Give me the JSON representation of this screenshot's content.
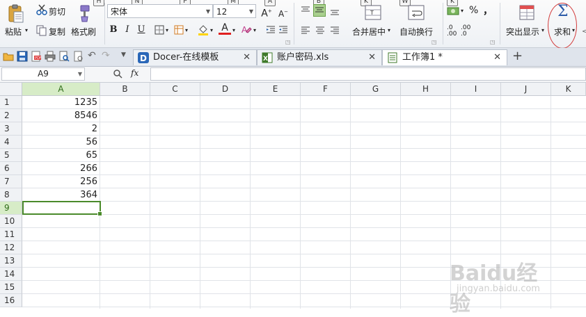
{
  "ribbon": {
    "paste_label": "粘贴",
    "cut_label": "剪切",
    "copy_label": "复制",
    "format_painter_label": "格式刷",
    "font_name": "宋体",
    "font_size": "12",
    "merge_center_label": "合并居中",
    "wrap_text_label": "自动换行",
    "highlight_label": "突出显示",
    "sum_label": "求和",
    "percent_symbol": "%",
    "comma_symbol": "，",
    "keytips": {
      "paste": "H",
      "font_name": "N",
      "font_size": "P",
      "font_size2": "M",
      "increase_font": "A",
      "align": "B",
      "merge": "K",
      "wrap": "W",
      "number": "K"
    },
    "accent_color": "#c0392b"
  },
  "tabs": [
    {
      "title": "Docer-在线模板",
      "close": "✕",
      "icon": "docer-icon"
    },
    {
      "title": "账户密码.xls",
      "close": "✕",
      "icon": "excel-icon"
    },
    {
      "title": "工作簿1 *",
      "close": "✕",
      "icon": "workbook-icon"
    }
  ],
  "new_tab_symbol": "+",
  "formula_bar": {
    "name_box": "A9",
    "fx_label": "fx",
    "formula": ""
  },
  "columns": [
    "A",
    "B",
    "C",
    "D",
    "E",
    "F",
    "G",
    "H",
    "I",
    "J",
    "K"
  ],
  "rows": [
    "1",
    "2",
    "3",
    "4",
    "5",
    "6",
    "7",
    "8",
    "9",
    "10",
    "11",
    "12",
    "13",
    "14",
    "15",
    "16"
  ],
  "column_a_values": [
    "1235",
    "8546",
    "2",
    "56",
    "65",
    "266",
    "256",
    "364"
  ],
  "selected_cell": "A9",
  "watermark": {
    "big": "Baidu经验",
    "small": "jingyan.baidu.com"
  }
}
